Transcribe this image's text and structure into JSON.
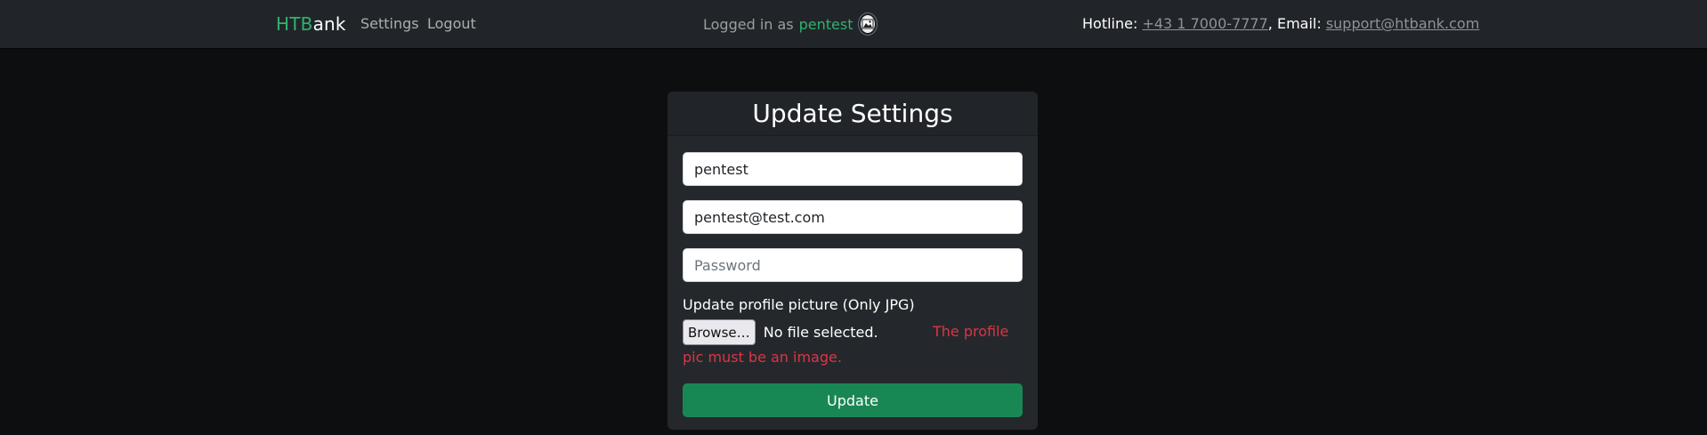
{
  "navbar": {
    "brand_accent": "HTB",
    "brand_rest": "ank",
    "links": [
      "Settings",
      "Logout"
    ],
    "login_prefix": "Logged in as",
    "username": "pentest",
    "avatar_icon": "profile-picture-icon",
    "contact": {
      "hotline_label": "Hotline: ",
      "hotline": "+43 1 7000-7777",
      "separator": ", Email: ",
      "email": "support@htbank.com"
    }
  },
  "card": {
    "title": "Update Settings",
    "username_value": "pentest",
    "email_value": "pentest@test.com",
    "password_placeholder": "Password",
    "file_label": "Update profile picture (Only JPG)",
    "browse_label": "Browse…",
    "no_file_text": "No file selected.",
    "error_part1": "The profile",
    "error_part2": "pic must be an image.",
    "submit_label": "Update"
  },
  "colors": {
    "accent": "#2fb36e",
    "success_button": "#198754",
    "error": "#dc3545",
    "navbar_bg": "#212529",
    "page_bg": "#0d0e0f"
  }
}
